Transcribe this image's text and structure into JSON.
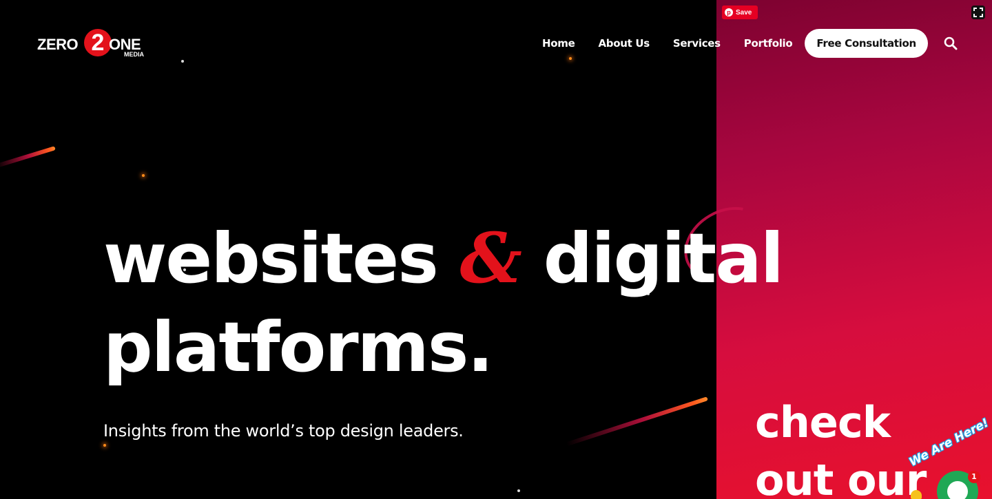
{
  "logo": {
    "left_text": "ZERO",
    "badge": "2",
    "right_text": "ONE",
    "sub_text": "MEDIA"
  },
  "nav": {
    "items": [
      {
        "label": "Home"
      },
      {
        "label": "About Us"
      },
      {
        "label": "Services"
      },
      {
        "label": "Portfolio"
      }
    ],
    "cta_label": "Free Consultation"
  },
  "pinterest": {
    "save_label": "Save"
  },
  "hero": {
    "line1_word1": "websites",
    "ampersand": "&",
    "line1_word2": "digital",
    "line2": "platforms.",
    "subtitle": "Insights from the world’s top design leaders."
  },
  "side_panel": {
    "line1": "check",
    "line2": "out our"
  },
  "chat": {
    "label": "We Are Here!",
    "badge_count": "1"
  },
  "colors": {
    "accent": "#e3121b",
    "background": "#000000",
    "panel_top": "#7d0230",
    "panel_bottom": "#e8112d",
    "chat_green": "#1fa855"
  },
  "icons": {
    "search": "search-icon",
    "expand": "expand-icon",
    "pinterest": "pinterest-icon",
    "chat": "chat-icon"
  }
}
